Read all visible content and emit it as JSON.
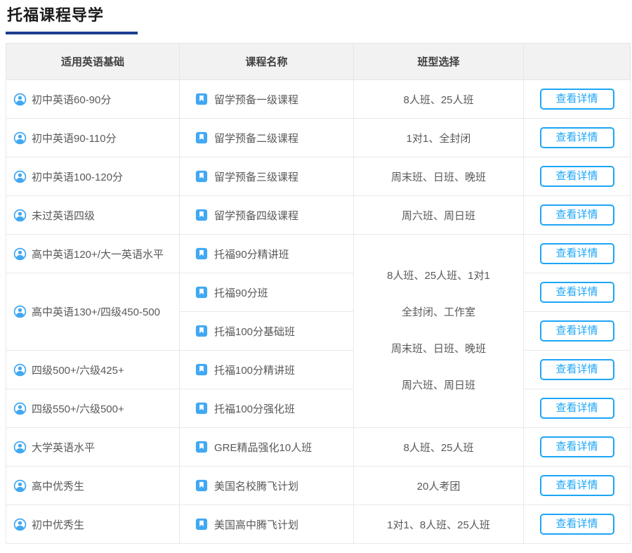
{
  "page": {
    "title": "托福课程导学"
  },
  "colors": {
    "accent": "#1ca6f7",
    "icon": "#41a8f3",
    "underline": "#1d3d8f"
  },
  "table": {
    "headers": [
      "适用英语基础",
      "课程名称",
      "班型选择",
      ""
    ],
    "view_details_label": "查看详情",
    "merged_class_types": [
      "8人班、25人班、1对1",
      "全封闭、工作室",
      "周末班、日班、晚班",
      "周六班、周日班"
    ],
    "rows": [
      {
        "basis": "初中英语60-90分",
        "course": "留学预备一级课程",
        "class_type": "8人班、25人班"
      },
      {
        "basis": "初中英语90-110分",
        "course": "留学预备二级课程",
        "class_type": "1对1、全封闭"
      },
      {
        "basis": "初中英语100-120分",
        "course": "留学预备三级课程",
        "class_type": "周末班、日班、晚班"
      },
      {
        "basis": "未过英语四级",
        "course": "留学预备四级课程",
        "class_type": "周六班、周日班"
      },
      {
        "basis": "高中英语120+/大一英语水平",
        "course": "托福90分精讲班"
      },
      {
        "basis": "高中英语130+/四级450-500",
        "course": "托福90分班"
      },
      {
        "course": "托福100分基础班"
      },
      {
        "basis": "四级500+/六级425+",
        "course": "托福100分精讲班"
      },
      {
        "basis": "四级550+/六级500+",
        "course": "托福100分强化班"
      },
      {
        "basis": "大学英语水平",
        "course": "GRE精品强化10人班",
        "class_type": "8人班、25人班"
      },
      {
        "basis": "高中优秀生",
        "course": "美国名校腾飞计划",
        "class_type": "20人考团"
      },
      {
        "basis": "初中优秀生",
        "course": "美国高中腾飞计划",
        "class_type": "1对1、8人班、25人班"
      }
    ]
  }
}
